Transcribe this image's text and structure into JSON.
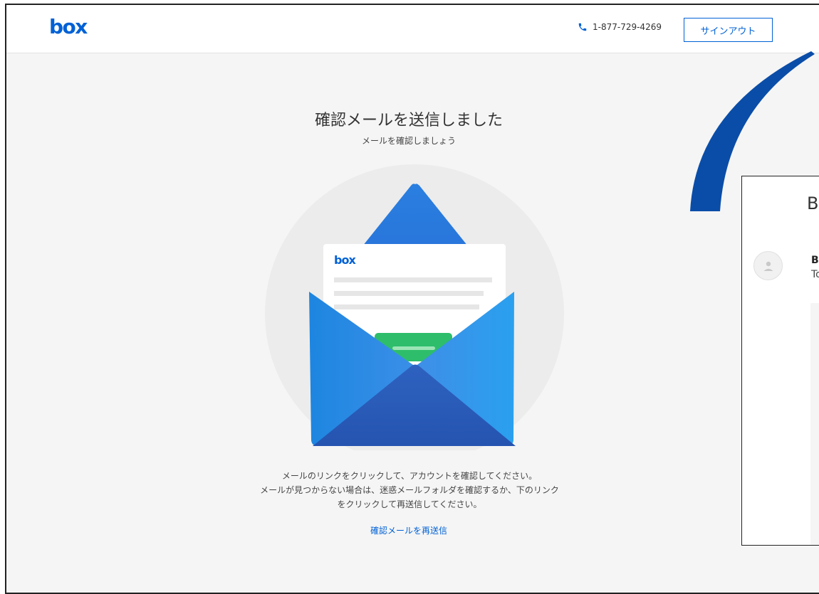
{
  "header": {
    "logo_text": "box",
    "phone_number": "1-877-729-4269",
    "signout_label": "サインアウト"
  },
  "main": {
    "title": "確認メールを送信しました",
    "subtitle": "メールを確認しましょう",
    "illustration_logo_text": "box",
    "instructions": [
      "メールのリンクをクリックして、アカウントを確認してください。",
      "メールが見つからない場合は、迷惑メールフォルダを確認するか、下のリンク",
      "をクリックして再送信してください。"
    ],
    "resend_link": "確認メールを再送信"
  },
  "email_preview": {
    "title_partial": "B",
    "sender_partial": "B",
    "to_partial": "To"
  },
  "colors": {
    "brand_blue": "#0061d5",
    "arc_blue": "#0a4da8",
    "button_green": "#2ebd6b",
    "page_bg": "#f5f5f5"
  }
}
